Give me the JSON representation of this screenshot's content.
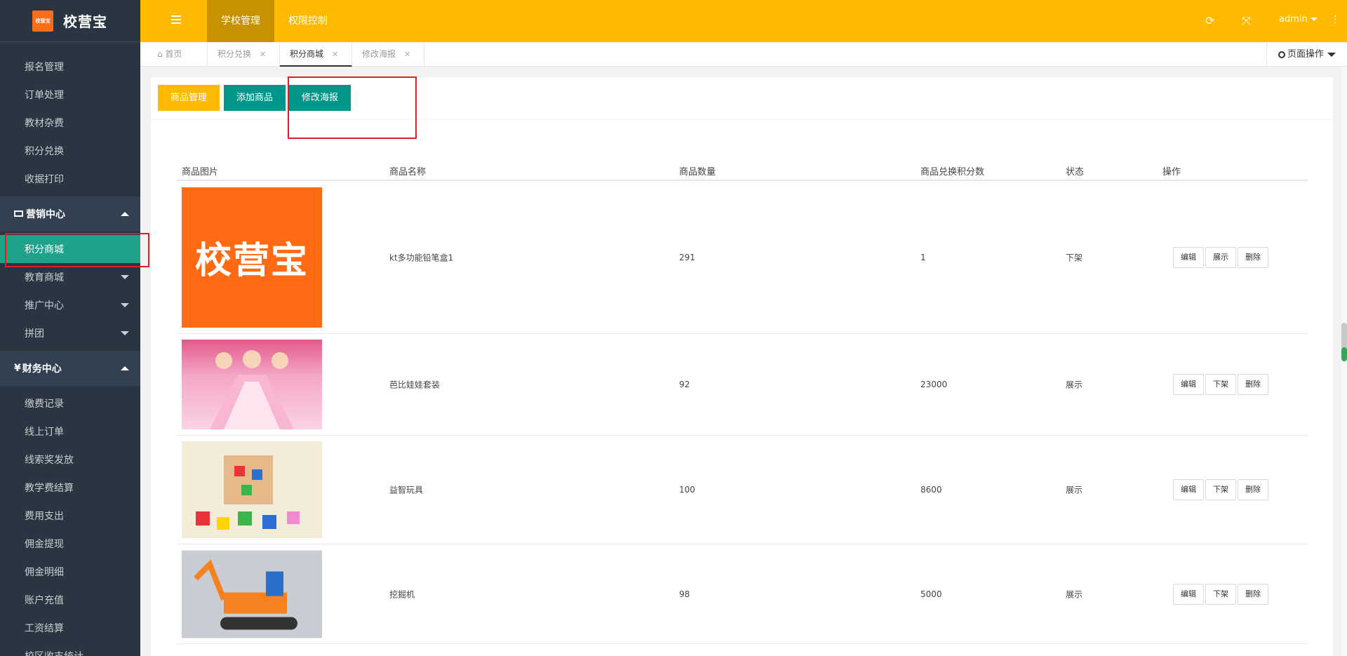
{
  "app": {
    "logo_small": "校营宝",
    "logo_text": "校营宝"
  },
  "sidebar": {
    "items_top": [
      "报名管理",
      "订单处理",
      "教材杂费",
      "积分兑换",
      "收据打印"
    ],
    "group_marketing": "营销中心",
    "items_marketing": [
      {
        "label": "积分商城",
        "active": true
      },
      {
        "label": "教育商城",
        "expandable": true
      },
      {
        "label": "推广中心",
        "expandable": true
      },
      {
        "label": "拼团",
        "expandable": true
      }
    ],
    "group_finance": "财务中心",
    "finance_prefix": "¥",
    "items_finance": [
      "缴费记录",
      "线上订单",
      "线索奖发放",
      "教学费结算",
      "费用支出",
      "佣金提现",
      "佣金明细",
      "账户充值",
      "工资结算",
      "校区收支统计"
    ]
  },
  "header": {
    "tabs": [
      {
        "label": "学校管理",
        "active": true
      },
      {
        "label": "权限控制",
        "active": false
      }
    ],
    "refresh_icon": "⟳",
    "fullscreen_icon": "⤧",
    "user": "admin",
    "more_icon": "⋮"
  },
  "tabbar": {
    "tabs": [
      {
        "label": "首页",
        "icon": "⌂",
        "closable": false,
        "active": false
      },
      {
        "label": "积分兑换",
        "closable": true,
        "active": false
      },
      {
        "label": "积分商城",
        "closable": true,
        "active": true
      },
      {
        "label": "修改海报",
        "closable": true,
        "active": false
      }
    ],
    "close_glyph": "✕",
    "page_ops": "页面操作"
  },
  "toolbar": {
    "manage": "商品管理",
    "add": "添加商品",
    "poster": "修改海报"
  },
  "table": {
    "headers": {
      "image": "商品图片",
      "name": "商品名称",
      "qty": "商品数量",
      "points": "商品兑换积分数",
      "status": "状态",
      "ops": "操作"
    },
    "rows": [
      {
        "name": "kt多功能铅笔盒1",
        "qty": "291",
        "points": "1",
        "status": "下架",
        "ops": [
          "编辑",
          "展示",
          "删除"
        ],
        "img": "logo",
        "img_text": "校营宝"
      },
      {
        "name": "芭比娃娃套装",
        "qty": "92",
        "points": "23000",
        "status": "展示",
        "ops": [
          "编辑",
          "下架",
          "删除"
        ],
        "img": "doll"
      },
      {
        "name": "益智玩具",
        "qty": "100",
        "points": "8600",
        "status": "展示",
        "ops": [
          "编辑",
          "下架",
          "删除"
        ],
        "img": "blocks"
      },
      {
        "name": "挖掘机",
        "qty": "98",
        "points": "5000",
        "status": "展示",
        "ops": [
          "编辑",
          "下架",
          "删除"
        ],
        "img": "excavator"
      }
    ]
  },
  "colors": {
    "primary": "#ffb900",
    "teal": "#00978a",
    "sidebar": "#2a3542",
    "active_nav": "#1fa28a",
    "highlight": "#e02020"
  }
}
